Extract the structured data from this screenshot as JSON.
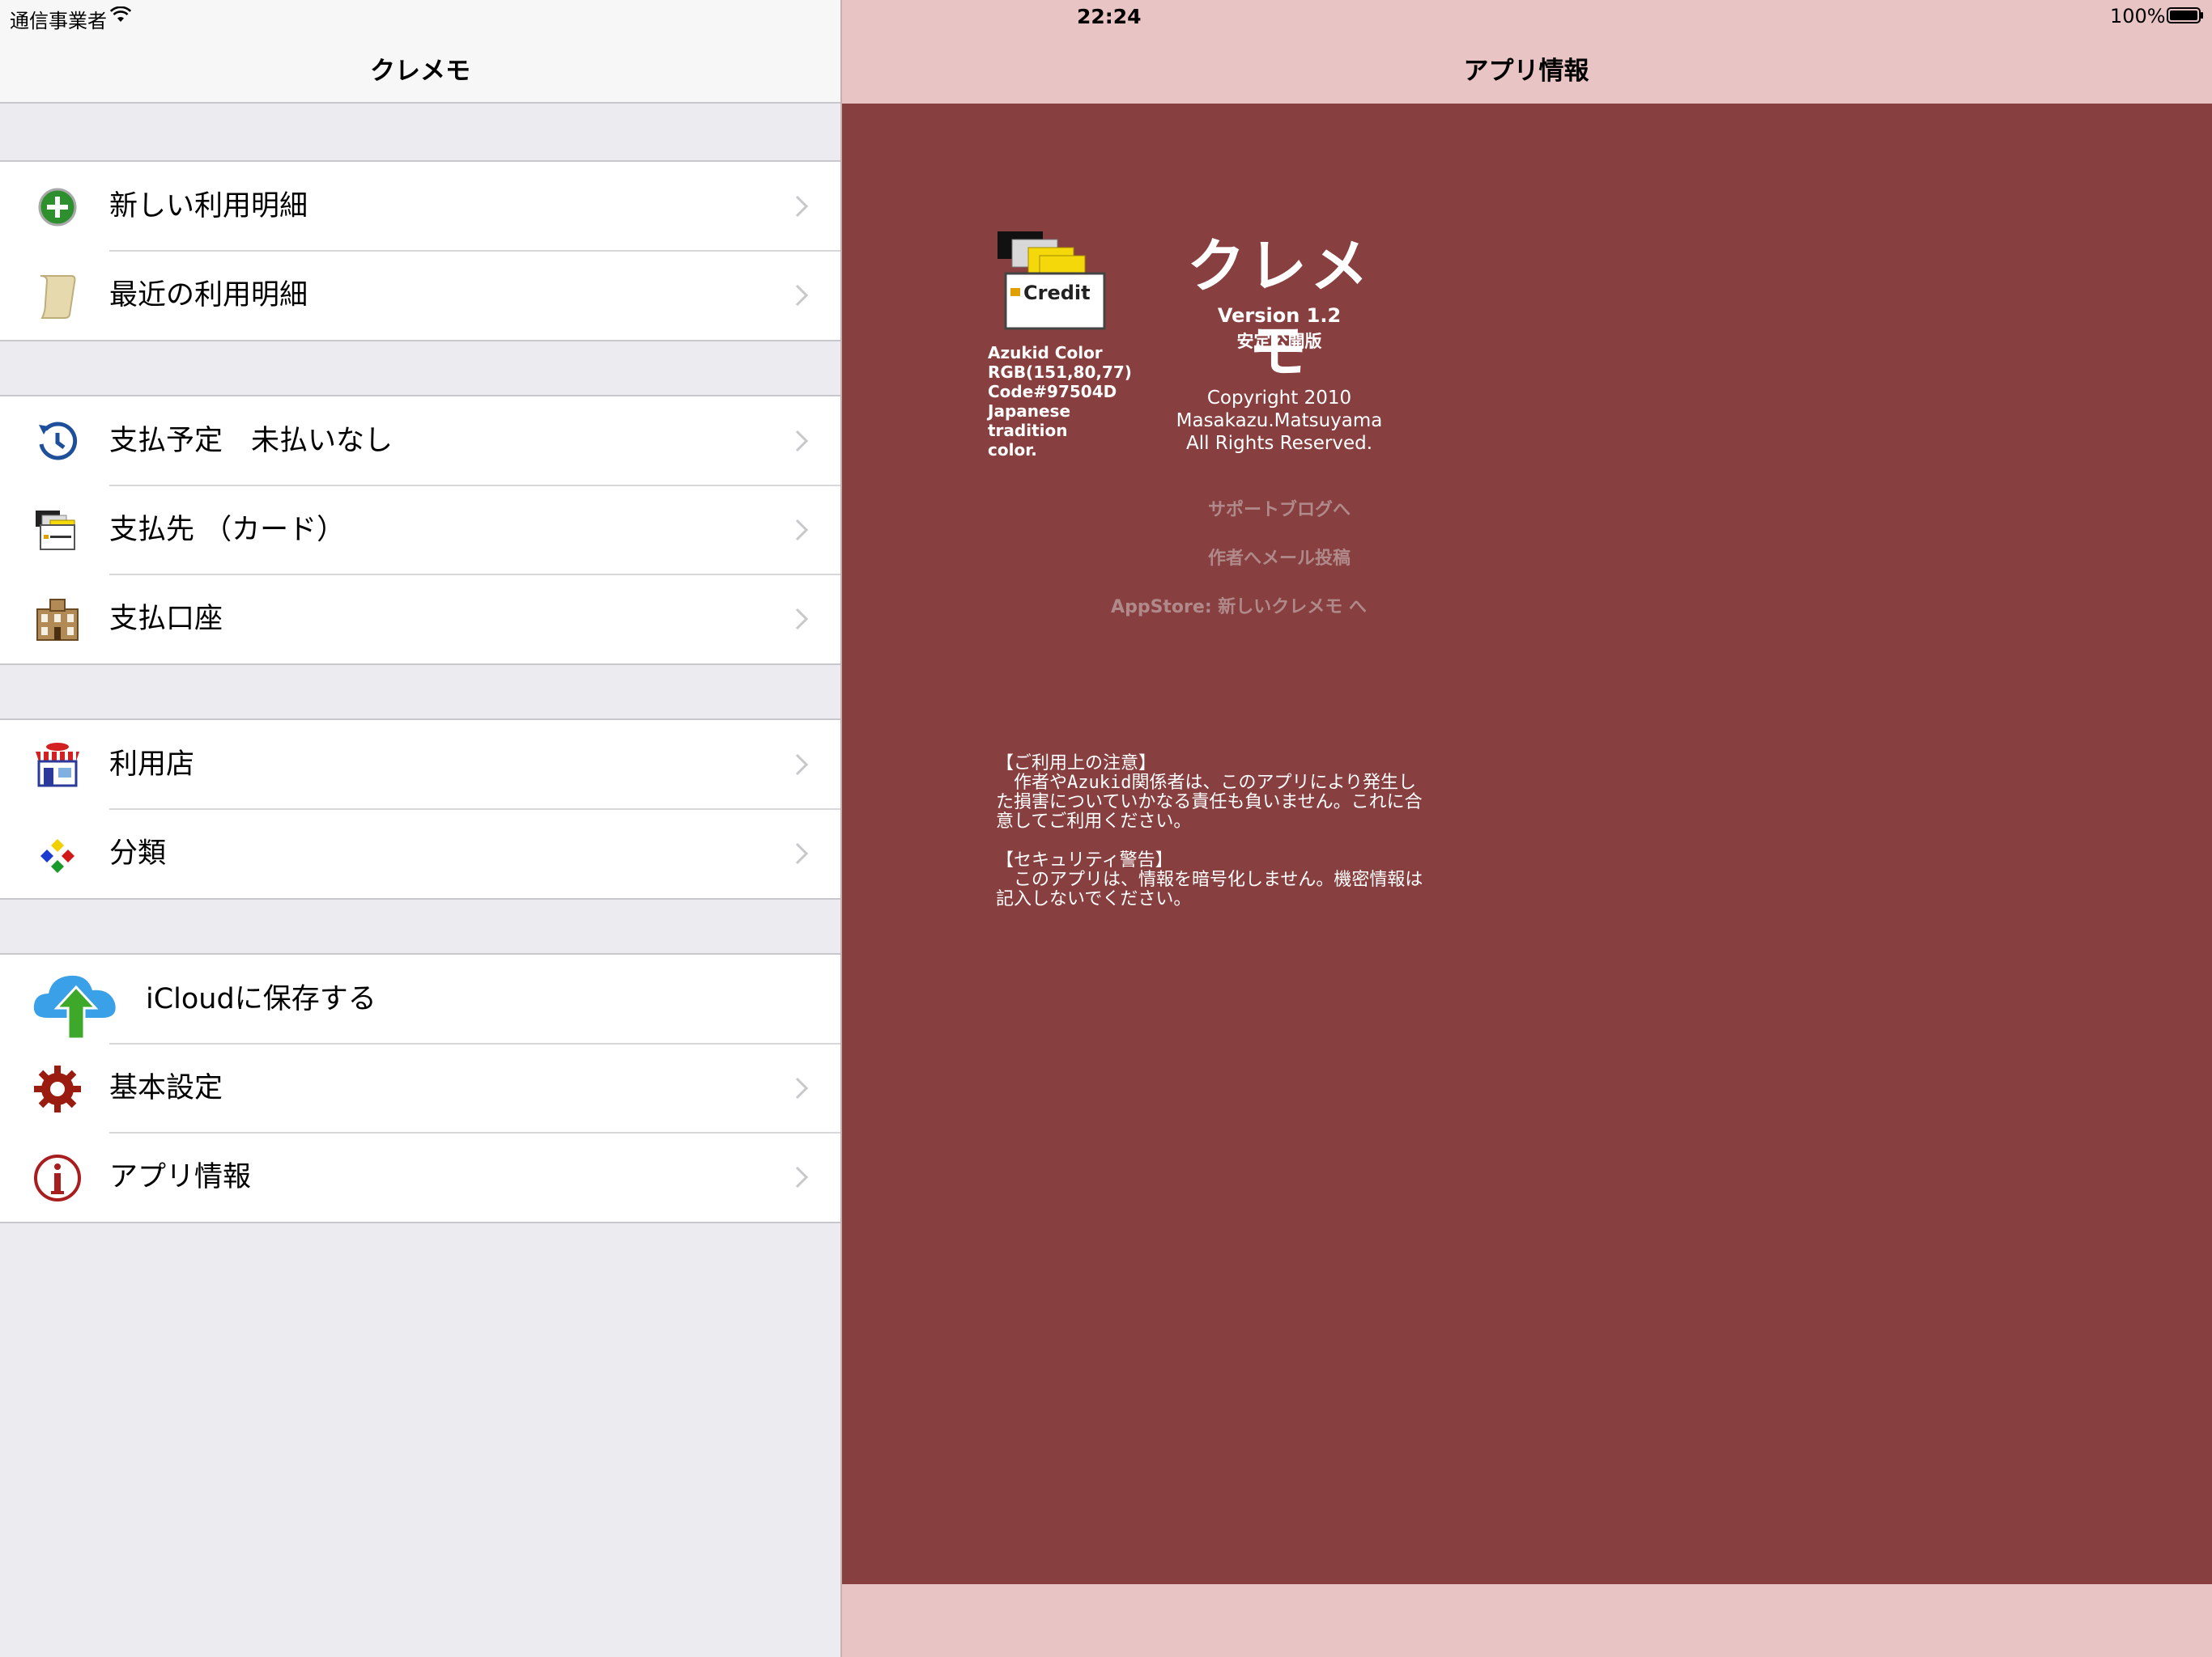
{
  "status_bar": {
    "carrier": "通信事業者",
    "time": "22:24",
    "battery": "100%"
  },
  "master": {
    "title": "クレメモ",
    "groups": [
      [
        {
          "label": "新しい利用明細",
          "icon": "add-icon"
        },
        {
          "label": "最近の利用明細",
          "icon": "scroll-icon"
        }
      ],
      [
        {
          "label": "支払予定　未払いなし",
          "icon": "history-icon"
        },
        {
          "label": "支払先 （カード）",
          "icon": "payment-card-icon"
        },
        {
          "label": "支払口座",
          "icon": "bank-icon"
        }
      ],
      [
        {
          "label": "利用店",
          "icon": "shop-icon"
        },
        {
          "label": "分類",
          "icon": "category-icon"
        }
      ],
      [
        {
          "label": "iCloudに保存する",
          "icon": "icloud-upload-icon"
        },
        {
          "label": "基本設定",
          "icon": "gear-icon"
        },
        {
          "label": "アプリ情報",
          "icon": "info-icon"
        }
      ]
    ]
  },
  "detail": {
    "title": "アプリ情報",
    "app_name": "クレメモ",
    "version": "Version 1.2",
    "edition": "安定公開版",
    "icon_badge": "Credit",
    "color_note": "Azukid Color\nRGB(151,80,77)\nCode#97504D\nJapanese\ntradition\ncolor.",
    "copyright": "Copyright 2010\nMasakazu.Matsuyama\nAll Rights Reserved.",
    "links": {
      "support_blog": "サポートブログへ",
      "mail_author": "作者へメール投稿",
      "appstore": "AppStore: 新しいクレメモ へ"
    },
    "notice": "【ご利用上の注意】\n　作者やAzukid関係者は、このアプリにより発生した損害についていかなる責任も負いません。これに合意してご利用ください。\n\n【セキュリティ警告】\n　このアプリは、情報を暗号化しません。機密情報は記入しないでください。"
  },
  "colors": {
    "azukid": "#97504D",
    "content_bg": "#873f3f",
    "nav_bg": "#e8c5c4"
  }
}
